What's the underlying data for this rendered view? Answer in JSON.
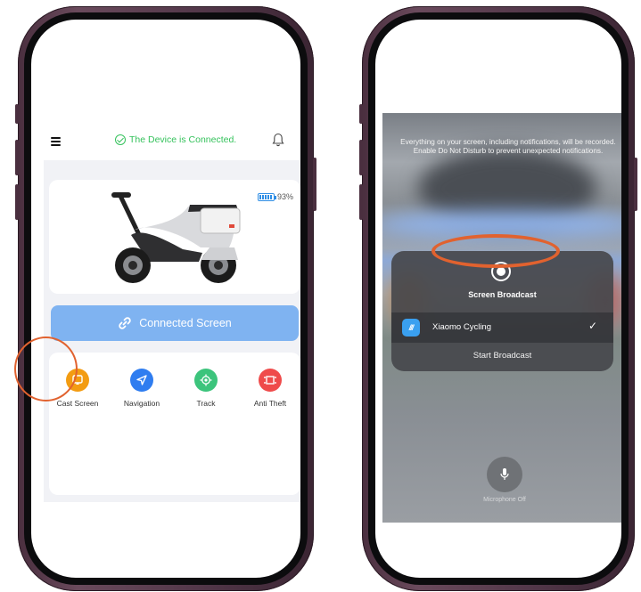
{
  "left_phone": {
    "status_text": "The Device is Connected.",
    "battery_percent": "93%",
    "connected_screen_label": "Connected Screen",
    "tools": [
      {
        "label": "Cast Screen",
        "icon": "cast-screen-icon",
        "color": "#f39c12"
      },
      {
        "label": "Navigation",
        "icon": "navigation-icon",
        "color": "#2f7df0"
      },
      {
        "label": "Track",
        "icon": "location-target-icon",
        "color": "#3cc47c"
      },
      {
        "label": "Anti Theft",
        "icon": "anti-theft-icon",
        "color": "#ef4b4b"
      }
    ],
    "highlight_color": "#e1622f"
  },
  "right_phone": {
    "notice": "Everything on your screen, including notifications, will be recorded. Enable Do Not Disturb to prevent unexpected notifications.",
    "sheet_title": "Screen Broadcast",
    "app_logo_text": "///",
    "app_name": "Xiaomo Cycling",
    "start_label": "Start Broadcast",
    "mic_label": "Microphone Off",
    "highlight_color": "#e1622f"
  }
}
